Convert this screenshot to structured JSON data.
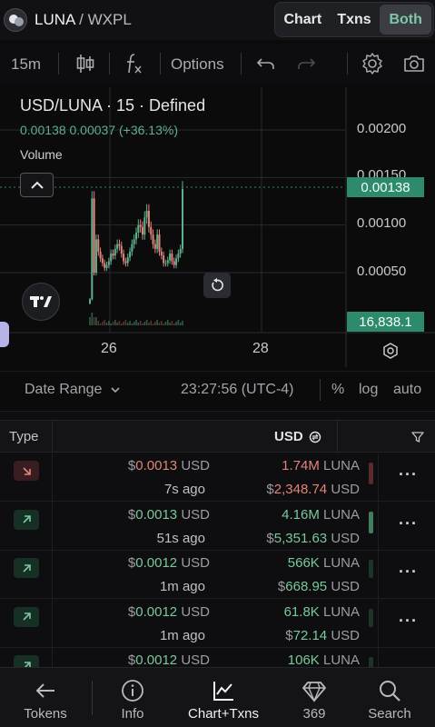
{
  "header": {
    "base_token": "LUNA",
    "quote_token": "WXPL",
    "separator": "/",
    "view_tabs": [
      {
        "label": "Chart",
        "active": false
      },
      {
        "label": "Txns",
        "active": false
      },
      {
        "label": "Both",
        "active": true
      }
    ]
  },
  "toolbar": {
    "interval": "15m",
    "candles_icon": "candlestick-icon",
    "indicators_icon": "function-icon",
    "options_label": "Options",
    "undo_icon": "undo-icon",
    "redo_icon": "redo-icon",
    "settings_icon": "gear-icon",
    "snapshot_icon": "camera-icon"
  },
  "chart": {
    "symbol_line": "USD/LUNA · 15 · Defined",
    "last_price": "0.00138",
    "change_abs": "0.00037",
    "change_pct": "(+36.13%)",
    "volume_label": "Volume",
    "price_badge": "0.00138",
    "volume_badge": "16,838.1",
    "y_ticks": [
      "0.00200",
      "0.00150",
      "0.00100",
      "0.00050"
    ],
    "x_ticks": [
      "26",
      "28"
    ],
    "colors": {
      "up": "#5fb08c",
      "down": "#e2847a",
      "badge": "#2d8a6c"
    }
  },
  "chart_data": {
    "type": "candlestick",
    "symbol": "USD/LUNA",
    "interval": "15",
    "ylim": [
      0.0,
      0.0023
    ],
    "y_ticks": [
      0.002,
      0.0015,
      0.001,
      0.0005
    ],
    "x_ticks": [
      "26",
      "28"
    ],
    "last_price": 0.00138,
    "last_volume": 16838.1,
    "series": [
      {
        "name": "close",
        "values": [
          0.00022,
          0.00128,
          0.0005,
          0.00085,
          0.00072,
          0.00065,
          0.0006,
          0.00055,
          0.00058,
          0.00062,
          0.0007,
          0.00068,
          0.00075,
          0.0008,
          0.00078,
          0.0007,
          0.00062,
          0.0006,
          0.00066,
          0.00072,
          0.0008,
          0.00085,
          0.00092,
          0.001,
          0.00098,
          0.0009,
          0.00108,
          0.00115,
          0.00098,
          0.0009,
          0.0008,
          0.00075,
          0.0009,
          0.00072,
          0.00068,
          0.0006,
          0.0006,
          0.00063,
          0.0007,
          0.00062,
          0.00058,
          0.00065,
          0.0007,
          0.00075,
          0.00138
        ]
      }
    ]
  },
  "range_bar": {
    "date_range_label": "Date Range",
    "clock": "23:27:56 (UTC-4)",
    "pct_label": "%",
    "log_label": "log",
    "auto_label": "auto"
  },
  "txns": {
    "col_type": "Type",
    "col_usd": "USD",
    "rows": [
      {
        "side": "sell",
        "price_cur": "$",
        "price": "0.0013",
        "price_unit": "USD",
        "ago": "7s ago",
        "amount": "1.74",
        "amount_suffix": "M",
        "amount_unit": "LUNA",
        "value_cur": "$",
        "value": "2,348.74",
        "value_unit": "USD"
      },
      {
        "side": "buy",
        "price_cur": "$",
        "price": "0.0013",
        "price_unit": "USD",
        "ago": "51s ago",
        "amount": "4.16",
        "amount_suffix": "M",
        "amount_unit": "LUNA",
        "value_cur": "$",
        "value": "5,351.63",
        "value_unit": "USD"
      },
      {
        "side": "buy",
        "price_cur": "$",
        "price": "0.0012",
        "price_unit": "USD",
        "ago": "1m ago",
        "amount": "566",
        "amount_suffix": "K",
        "amount_unit": "LUNA",
        "value_cur": "$",
        "value": "668.95",
        "value_unit": "USD"
      },
      {
        "side": "buy",
        "price_cur": "$",
        "price": "0.0012",
        "price_unit": "USD",
        "ago": "1m ago",
        "amount": "61.8",
        "amount_suffix": "K",
        "amount_unit": "LUNA",
        "value_cur": "$",
        "value": "72.14",
        "value_unit": "USD"
      },
      {
        "side": "buy",
        "price_cur": "$",
        "price": "0.0012",
        "price_unit": "USD",
        "ago": "",
        "amount": "106",
        "amount_suffix": "K",
        "amount_unit": "LUNA",
        "value_cur": "",
        "value": "",
        "value_unit": ""
      }
    ]
  },
  "bottom_nav": [
    {
      "label": "Tokens",
      "icon": "arrow-left-icon",
      "active": false
    },
    {
      "label": "Info",
      "icon": "info-icon",
      "active": false
    },
    {
      "label": "Chart+Txns",
      "icon": "chart-line-icon",
      "active": true
    },
    {
      "label": "369",
      "icon": "diamond-icon",
      "active": false
    },
    {
      "label": "Search",
      "icon": "search-icon",
      "active": false
    }
  ]
}
